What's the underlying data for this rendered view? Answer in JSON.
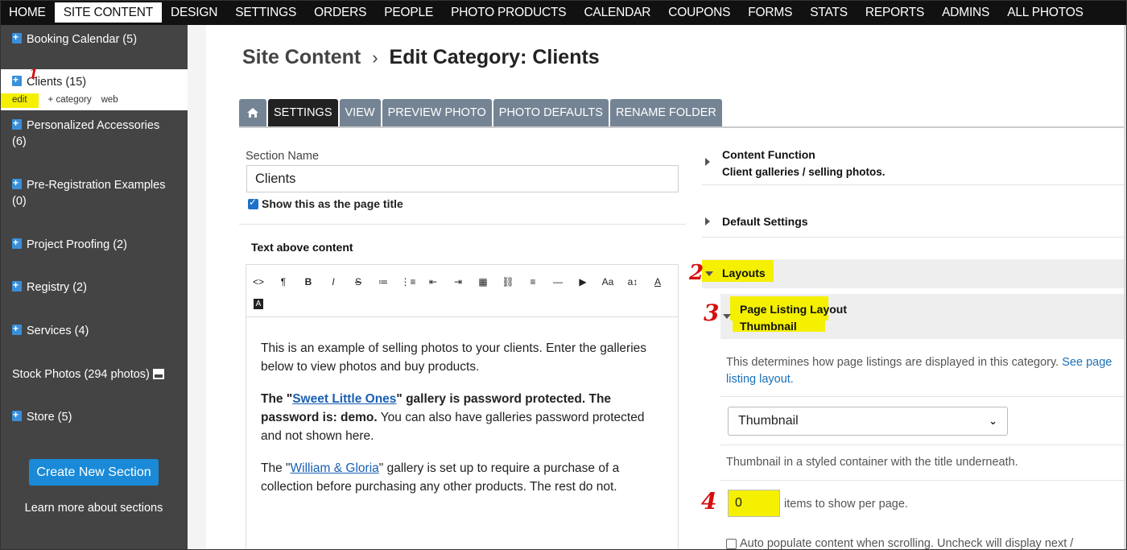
{
  "nav": [
    "HOME",
    "SITE CONTENT",
    "DESIGN",
    "SETTINGS",
    "ORDERS",
    "PEOPLE",
    "PHOTO PRODUCTS",
    "CALENDAR",
    "COUPONS",
    "FORMS",
    "STATS",
    "REPORTS",
    "ADMINS",
    "ALL PHOTOS"
  ],
  "sidebar": {
    "items": [
      {
        "label": "Booking Calendar (5)"
      },
      {
        "label": "Clients (15)",
        "sub": [
          "edit",
          "+ category",
          "web"
        ]
      },
      {
        "label": "Personalized Accessories",
        "label2": "(6)"
      },
      {
        "label": "Pre-Registration Examples",
        "label2": "(0)"
      },
      {
        "label": "Project Proofing (2)"
      },
      {
        "label": "Registry (2)"
      },
      {
        "label": "Services (4)"
      },
      {
        "label": "Stock Photos (294 photos)"
      },
      {
        "label": "Store (5)"
      }
    ],
    "create_button": "Create New Section",
    "learn_more": "Learn more about sections"
  },
  "breadcrumb": {
    "root": "Site Content",
    "current": "Edit Category: Clients"
  },
  "tabs": [
    "SETTINGS",
    "VIEW",
    "PREVIEW PHOTO",
    "PHOTO DEFAULTS",
    "RENAME FOLDER"
  ],
  "left_panel": {
    "section_name_label": "Section Name",
    "section_name_value": "Clients",
    "show_title_label": "Show this as the page title",
    "text_above_label": "Text above content",
    "toolbar_icons": [
      "code-view-icon",
      "paragraph-icon",
      "bold-icon",
      "italic-icon",
      "strikethrough-icon",
      "bullet-list-icon",
      "numbered-list-icon",
      "outdent-icon",
      "indent-icon",
      "table-icon",
      "link-icon",
      "align-left-icon",
      "horizontal-rule-icon",
      "video-icon",
      "font-size-icon",
      "line-height-icon",
      "text-color-icon",
      "background-color-icon"
    ],
    "toolbar_glyphs": [
      "<>",
      "¶",
      "B",
      "I",
      "S",
      "≔",
      "⋮≡",
      "⇤",
      "⇥",
      "▦",
      "⛓",
      "≡",
      "—",
      "▶",
      "Aa",
      "a↕",
      "A",
      "A"
    ],
    "p1": "This is an example of selling photos to your clients. Enter the galleries below to view photos and buy products.",
    "p2_pre": "The \"",
    "p2_link": "Sweet Little Ones",
    "p2_mid": "\" gallery is password protected. The password is: demo.",
    "p2_post": " You can also have galleries password protected and not shown here.",
    "p3_pre": "The \"",
    "p3_link": "William & Gloria",
    "p3_post": "\" gallery is set up to require a purchase of a collection before purchasing any other products. The rest do not."
  },
  "right_panel": {
    "content_function_title": "Content Function",
    "content_function_value": "Client galleries / selling photos.",
    "default_settings": "Default Settings",
    "layouts": "Layouts",
    "page_listing_title": "Page Listing Layout",
    "page_listing_value": "Thumbnail",
    "help_text": "This determines how page listings are displayed in this category.",
    "help_link": "See page listing layout.",
    "select_value": "Thumbnail",
    "select_desc": "Thumbnail in a styled container with the title underneath.",
    "items_value": "0",
    "items_label": "items to show per page.",
    "auto_populate": "Auto populate content when scrolling. Uncheck will display next /"
  },
  "annotations": [
    "1",
    "2",
    "3",
    "4"
  ],
  "colors": {
    "highlight": "#f4f000",
    "accent": "#1a8ad8",
    "tab": "#748494",
    "annotation": "#d60f0f"
  }
}
